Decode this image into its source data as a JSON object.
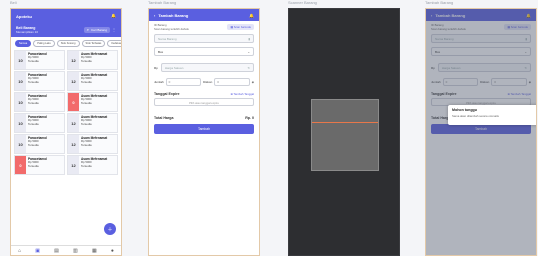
{
  "frames": [
    "Beli",
    "Tambah Barang",
    "Scanner Barang",
    "Tambah Barang"
  ],
  "home": {
    "app_title": "Apoteku",
    "section_label": "Beli Barang",
    "section_sub": "Menampilkan 10",
    "search_label": "Cari Barang",
    "chips": [
      "Semua",
      "Paling Laku",
      "Stok Kosong",
      "Stok Terbatas",
      "Kedaluwarsa"
    ],
    "cards": [
      {
        "qty": "10",
        "name": "Paracetamol",
        "price": "Rp 5000",
        "note": "Tersedia",
        "alert": false
      },
      {
        "qty": "12",
        "name": "Asam Mefenamat",
        "price": "Rp 5000",
        "note": "Tersedia",
        "alert": false
      },
      {
        "qty": "10",
        "name": "Paracetamol",
        "price": "Rp 5000",
        "note": "Tersedia",
        "alert": false
      },
      {
        "qty": "12",
        "name": "Asam Mefenamat",
        "price": "Rp 5000",
        "note": "Tersedia",
        "alert": false
      },
      {
        "qty": "10",
        "name": "Paracetamol",
        "price": "Rp 5000",
        "note": "Tersedia",
        "alert": false
      },
      {
        "qty": "0",
        "name": "Asam Mefenamat",
        "price": "Rp 5000",
        "note": "Tersedia",
        "alert": true
      },
      {
        "qty": "10",
        "name": "Paracetamol",
        "price": "Rp 5000",
        "note": "Tersedia",
        "alert": false
      },
      {
        "qty": "12",
        "name": "Asam Mefenamat",
        "price": "Rp 5000",
        "note": "Tersedia",
        "alert": false
      },
      {
        "qty": "10",
        "name": "Paracetamol",
        "price": "Rp 5000",
        "note": "Tersedia",
        "alert": false
      },
      {
        "qty": "12",
        "name": "Asam Mefenamat",
        "price": "Rp 5000",
        "note": "Tersedia",
        "alert": false
      },
      {
        "qty": "0",
        "name": "Paracetamol",
        "price": "Rp 5000",
        "note": "Tersedia",
        "alert": true
      },
      {
        "qty": "12",
        "name": "Asam Mefenamat",
        "price": "Rp 5000",
        "note": "Tersedia",
        "alert": false
      }
    ],
    "nav_icons": [
      "home-icon",
      "cart-icon",
      "box-icon",
      "factory-icon",
      "report-icon",
      "user-icon"
    ]
  },
  "form": {
    "title": "Tambah Barang",
    "info_line1": "ID Barang",
    "info_line2": "Scan barang terlebih dahulu",
    "scan_label": "Scan barcode",
    "name_placeholder": "Nama Barang",
    "unit_value": "Box",
    "price_label": "Rp",
    "price_placeholder": "Harga Satuan",
    "qty_label": "Jumlah",
    "qty_value": "0",
    "disc_label": "Diskon",
    "disc_value": "0",
    "expiry_label": "Tanggal Expire",
    "expiry_link": "Tambah Tanggal",
    "expiry_hint": "Pilih atau tanggal expire",
    "total_label": "Total Harga",
    "total_value": "Rp. 0",
    "submit_label": "Tambah"
  },
  "dialog": {
    "title": "Mohon tunggu",
    "message": "Sama akan ditambah secara otomatis"
  },
  "colors": {
    "accent": "#5a5fe0",
    "alert": "#f26b6b"
  }
}
